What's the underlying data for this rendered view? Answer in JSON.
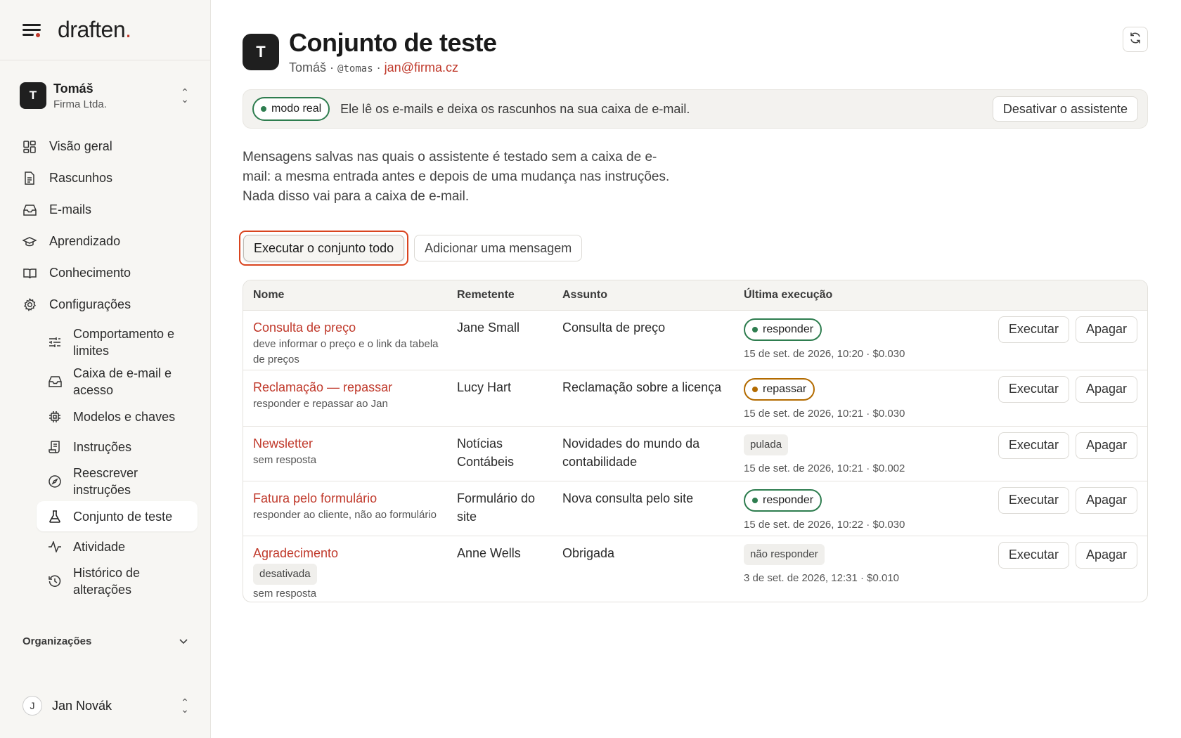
{
  "brand": {
    "name": "draften",
    "accent": "."
  },
  "account": {
    "initial": "T",
    "name": "Tomáš",
    "org": "Firma Ltda."
  },
  "nav": {
    "overview": "Visão geral",
    "drafts": "Rascunhos",
    "emails": "E-mails",
    "learning": "Aprendizado",
    "knowledge": "Conhecimento",
    "settings": "Configurações",
    "sub": {
      "behavior": "Comportamento e limites",
      "mailbox": "Caixa de e-mail e acesso",
      "models": "Modelos e chaves",
      "instructions": "Instruções",
      "rewrite": "Reescrever instruções",
      "testset": "Conjunto de teste",
      "activity": "Atividade",
      "history": "Histórico de alterações"
    }
  },
  "organizations_label": "Organizações",
  "user": {
    "initial": "J",
    "name": "Jan Novák"
  },
  "header": {
    "initial": "T",
    "title": "Conjunto de teste",
    "name": "Tomáš",
    "sep1": "·",
    "handle": "@tomas",
    "sep2": "·",
    "email": "jan@firma.cz"
  },
  "banner": {
    "mode": "modo real",
    "text": "Ele lê os e-mails e deixa os rascunhos na sua caixa de e-mail.",
    "disable_button": "Desativar o assistente"
  },
  "description": "Mensagens salvas nas quais o assistente é testado sem a caixa de e-mail: a mesma entrada antes e depois de uma mudança nas instruções. Nada disso vai para a caixa de e-mail.",
  "actions": {
    "run_all": "Executar o conjunto todo",
    "add_message": "Adicionar uma mensagem"
  },
  "table": {
    "headers": {
      "name": "Nome",
      "sender": "Remetente",
      "subject": "Assunto",
      "last_run": "Última execução"
    },
    "run_label": "Executar",
    "delete_label": "Apagar",
    "rows": [
      {
        "name": "Consulta de preço",
        "tag": "",
        "note": "deve informar o preço e o link da tabela de preços",
        "sender": "Jane Small",
        "subject": "Consulta de preço",
        "status": "responder",
        "status_style": "green",
        "meta": "15 de set. de 2026, 10:20 · $0.030"
      },
      {
        "name": "Reclamação — repassar",
        "tag": "",
        "note": "responder e repassar ao Jan",
        "sender": "Lucy Hart",
        "subject": "Reclamação sobre a licença",
        "status": "repassar",
        "status_style": "orange",
        "meta": "15 de set. de 2026, 10:21 · $0.030"
      },
      {
        "name": "Newsletter",
        "tag": "",
        "note": "sem resposta",
        "sender": "Notícias Contábeis",
        "subject": "Novidades do mundo da contabilidade",
        "status": "pulada",
        "status_style": "grey",
        "meta": "15 de set. de 2026, 10:21 · $0.002"
      },
      {
        "name": "Fatura pelo formulário",
        "tag": "",
        "note": "responder ao cliente, não ao formulário",
        "sender": "Formulário do site",
        "subject": "Nova consulta pelo site",
        "status": "responder",
        "status_style": "green",
        "meta": "15 de set. de 2026, 10:22 · $0.030"
      },
      {
        "name": "Agradecimento",
        "tag": "desativada",
        "note": "sem resposta",
        "sender": "Anne Wells",
        "subject": "Obrigada",
        "status": "não responder",
        "status_style": "grey",
        "meta": "3 de set. de 2026, 12:31 · $0.010"
      }
    ]
  },
  "colors": {
    "accent": "#c0392b",
    "green": "#2e7d4f",
    "orange": "#b36b00",
    "highlight": "#d9441f"
  }
}
